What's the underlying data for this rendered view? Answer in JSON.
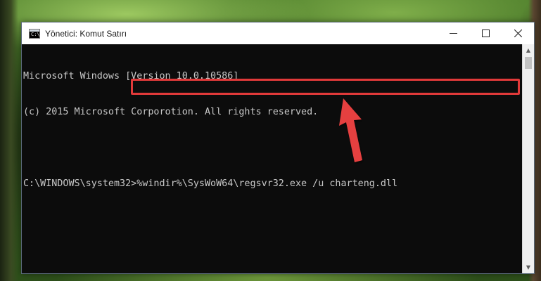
{
  "window": {
    "title": "Yönetici: Komut Satırı",
    "icon": "cmd-icon",
    "controls": [
      "minimize-icon",
      "maximize-icon",
      "close-icon"
    ]
  },
  "console": {
    "lines": [
      "Microsoft Windows [Version 10.0.10586]",
      "(c) 2015 Microsoft Corporotion. All rights reserved.",
      "",
      "C:\\WINDOWS\\system32>%windir%\\SysWoW64\\regsvr32.exe /u charteng.dll"
    ],
    "prompt": "C:\\WINDOWS\\system32>",
    "command": "%windir%\\SysWoW64\\regsvr32.exe /u charteng.dll"
  },
  "annotation": {
    "highlight_color": "#e23a3a",
    "arrow_color": "#e64040"
  },
  "colors": {
    "console_bg": "#0c0c0c",
    "console_text": "#c8c8c8"
  }
}
